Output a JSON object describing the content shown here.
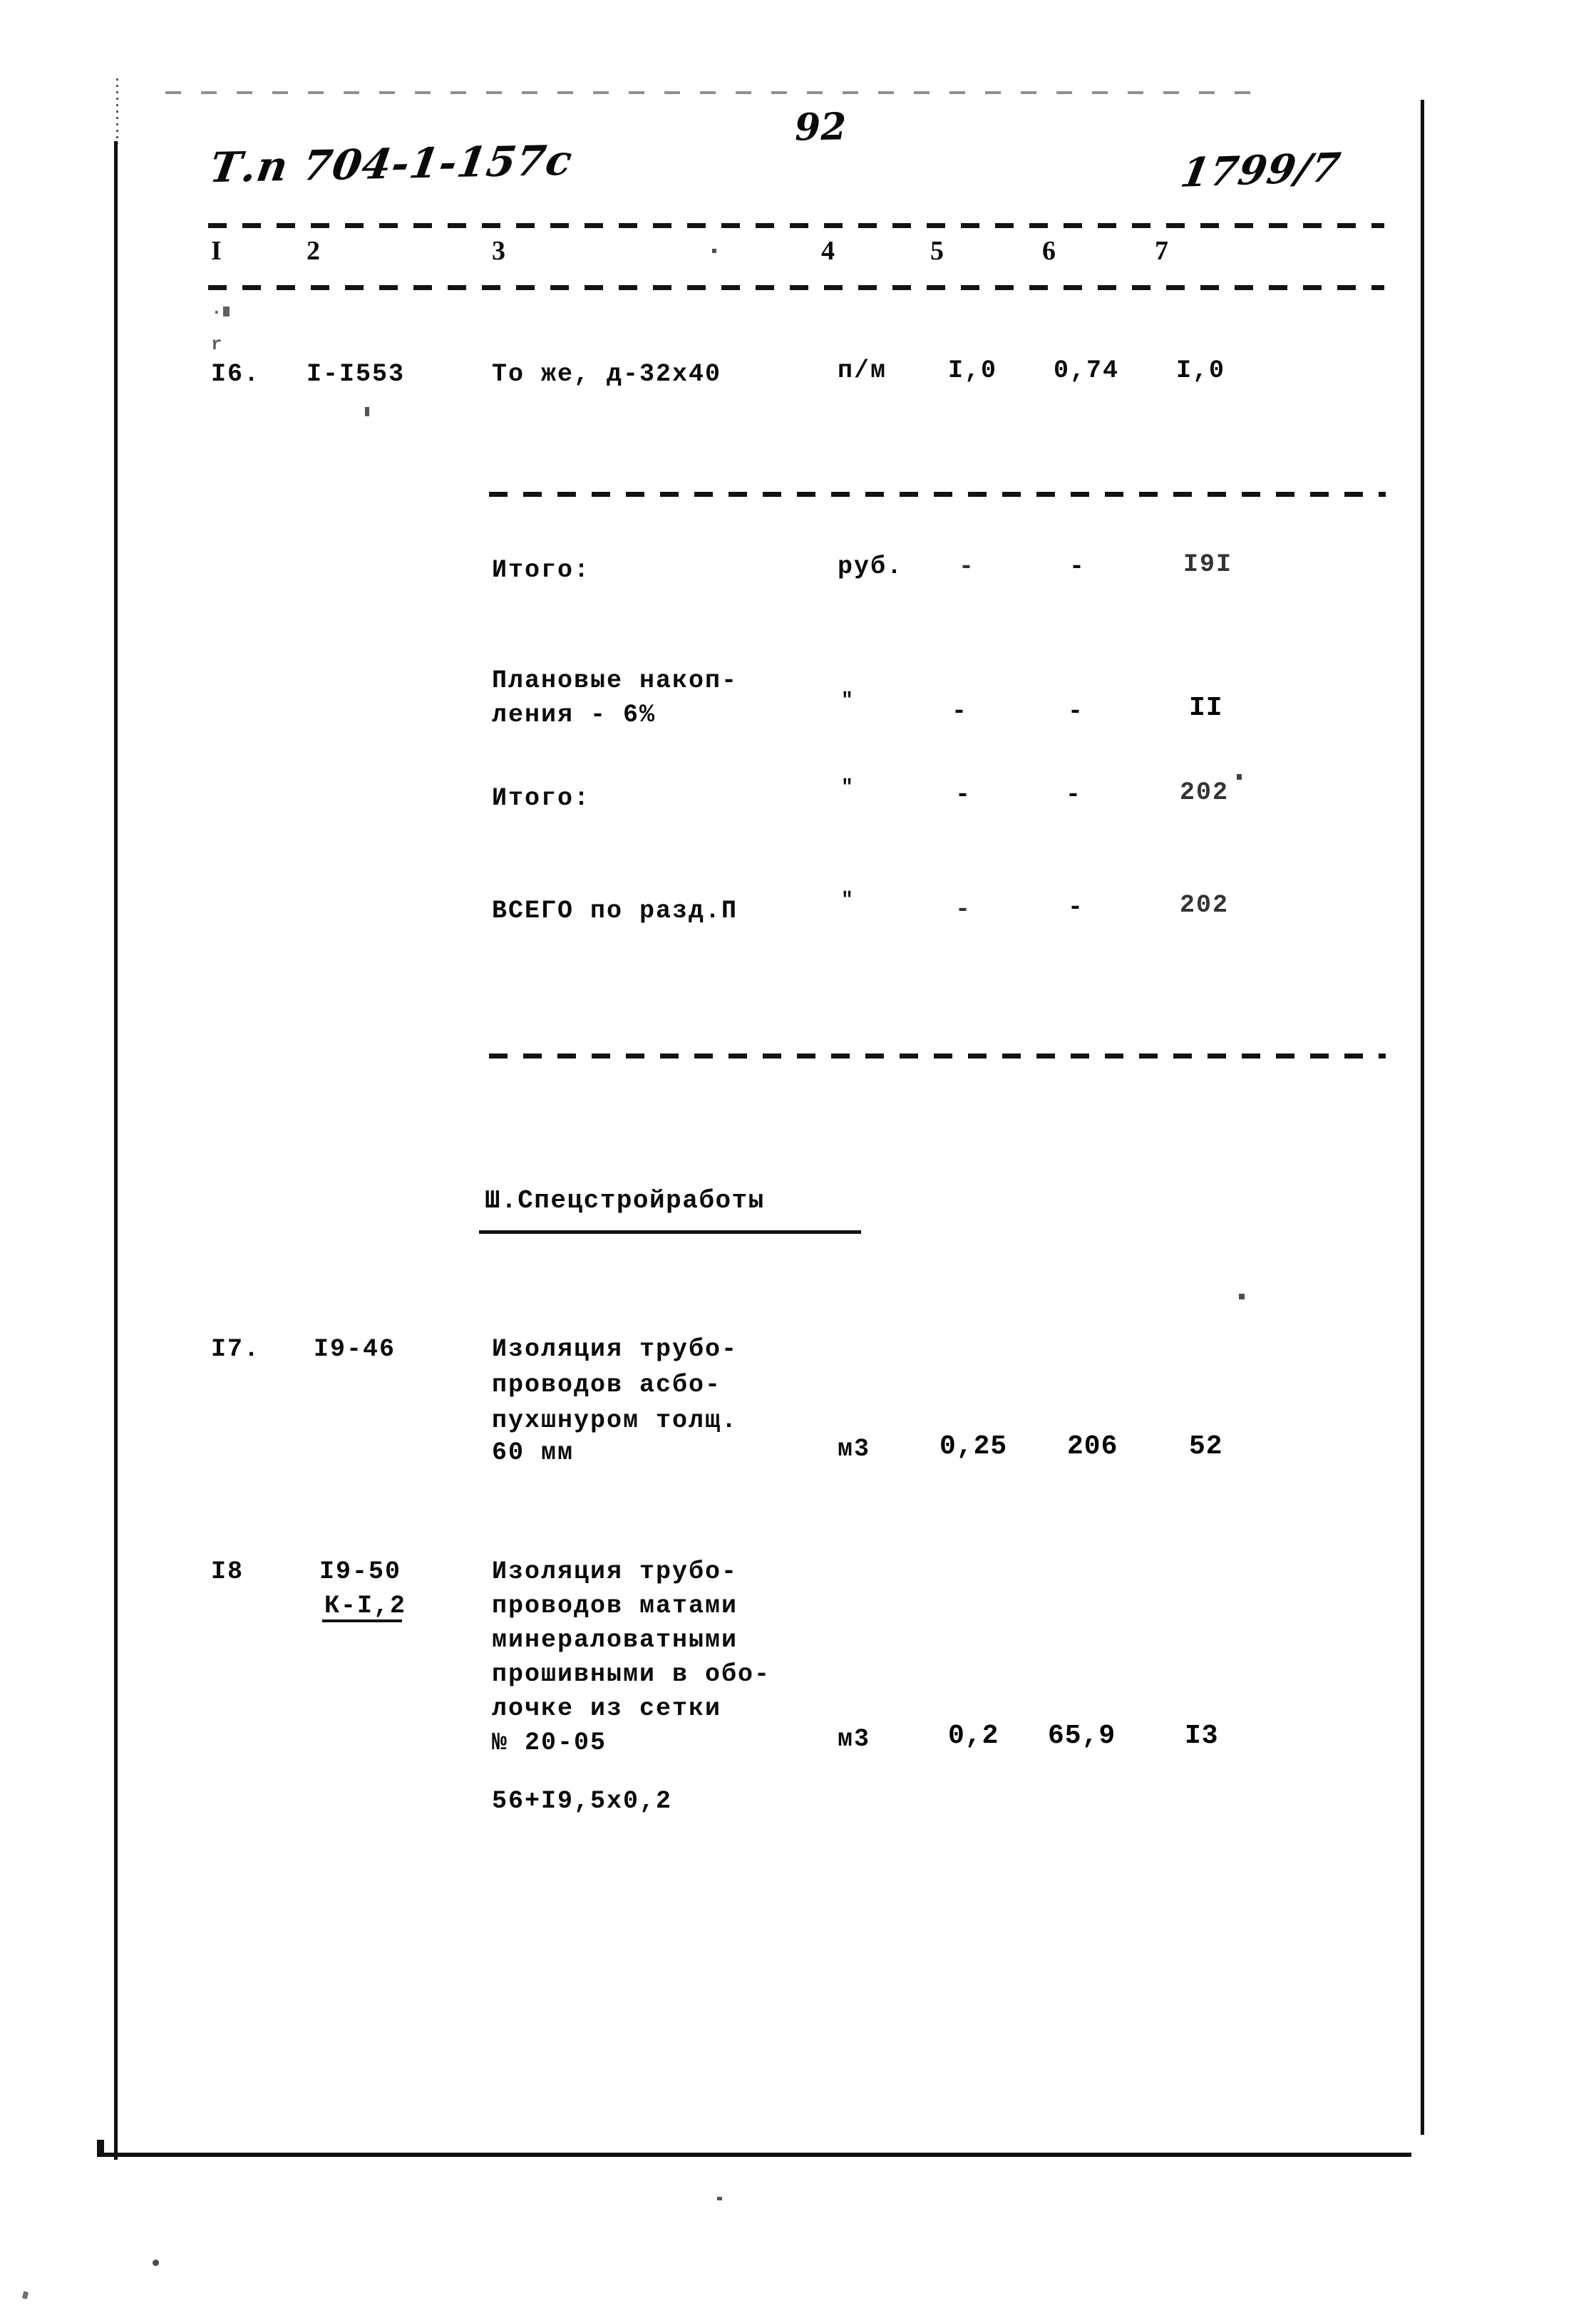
{
  "page": {
    "page_number": "92",
    "handwritten_code": "Т.п 704-1-157с",
    "handwritten_number": "1799/7"
  },
  "table": {
    "column_headers": [
      "I",
      "2",
      "3",
      "4",
      "5",
      "6",
      "7"
    ],
    "rows": [
      {
        "no": "I6.",
        "code": "I-I553",
        "description": [
          "То же, д-32х40"
        ],
        "unit": "п/м",
        "qty": "I,0",
        "price": "0,74",
        "total": "I,0"
      },
      {
        "no": "",
        "code": "",
        "description": [
          "Итого:"
        ],
        "unit": "руб.",
        "qty": "-",
        "price": "-",
        "total": "I9I"
      },
      {
        "no": "",
        "code": "",
        "description": [
          "Плановые накоп-",
          "ления - 6%"
        ],
        "unit": "\"",
        "qty": "-",
        "price": "-",
        "total": "II"
      },
      {
        "no": "",
        "code": "",
        "description": [
          "Итого:"
        ],
        "unit": "\"",
        "qty": "-",
        "price": "-",
        "total": "202"
      },
      {
        "no": "",
        "code": "",
        "description": [
          "ВСЕГО по разд.П"
        ],
        "unit": "\"",
        "qty": "-",
        "price": "-",
        "total": "202"
      },
      {
        "no": "I7.",
        "code": "I9-46",
        "description": [
          "Изоляция трубо-",
          "проводов асбо-",
          "пухшнуром толщ.",
          "60 мм"
        ],
        "unit": "м3",
        "qty": "0,25",
        "price": "206",
        "total": "52"
      },
      {
        "no": "I8",
        "code": "I9-50",
        "code2": "К-I,2",
        "description": [
          "Изоляция трубо-",
          "проводов матами",
          "минераловатными",
          "прошивными в обо-",
          "лочке из сетки",
          "№ 20-05"
        ],
        "unit": "м3",
        "qty": "0,2",
        "price": "65,9",
        "total": "I3"
      }
    ],
    "formula_note": "56+I9,5х0,2"
  },
  "section": {
    "heading": "Ш.Спецстройработы"
  }
}
